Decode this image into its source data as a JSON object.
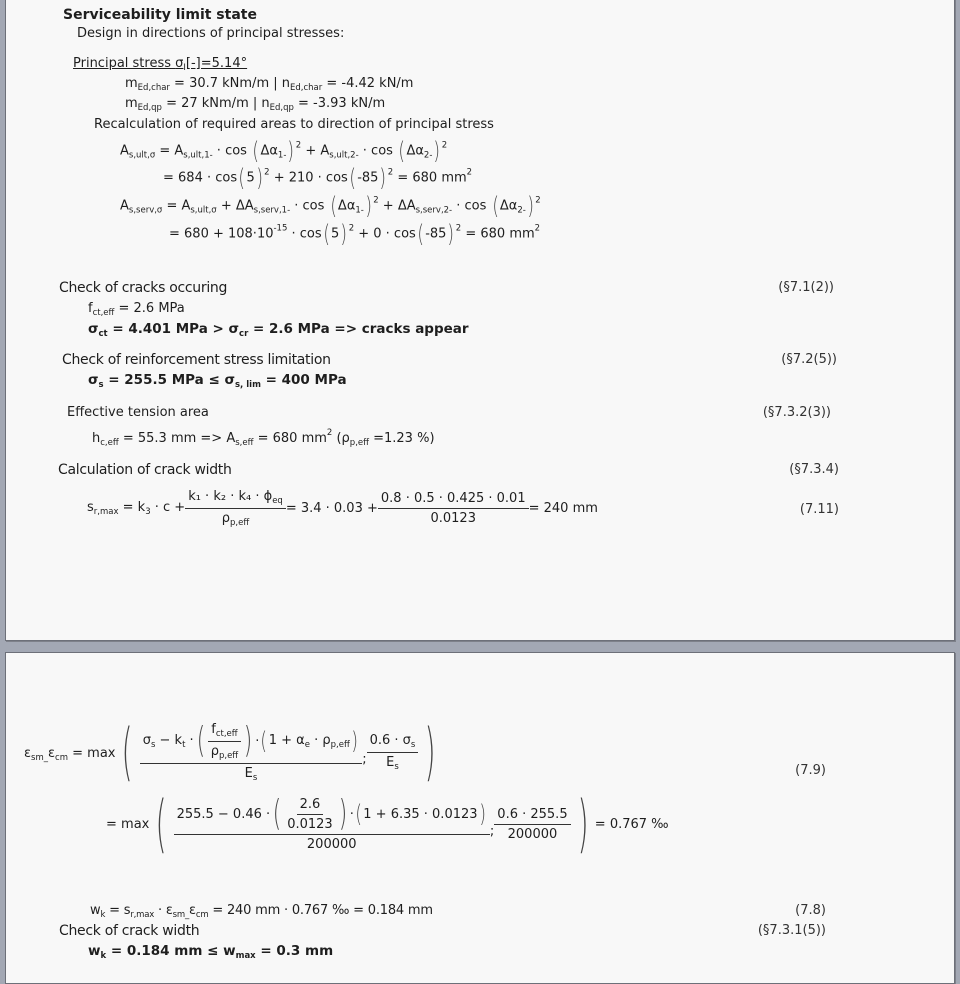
{
  "section": {
    "title": "Serviceability limit state",
    "subtitle": "Design in directions of principal stresses:"
  },
  "principal": {
    "label": "Principal stress",
    "sigma_label": "σ",
    "sigma_sub": "I",
    "sigma_rest": "[-]=5.14°",
    "char_line": {
      "m_sym": "m",
      "m_sub": "Ed,char",
      "m_val": " = 30.7  kNm/m  | ",
      "n_sym": "n",
      "n_sub": "Ed,char",
      "n_val": " = -4.42 kN/m"
    },
    "qp_line": {
      "m_sym": "m",
      "m_sub": "Ed,qp",
      "m_val": " = 27  kNm/m  | ",
      "n_sym": "n",
      "n_sub": "Ed,qp",
      "n_val": " = -3.93 kN/m"
    },
    "recalc_label": "Recalculation of required areas to direction of principal stress",
    "as_ult_formula": {
      "lhs": "A",
      "lhs_sub": "s,ult,σ",
      "t1": " = A",
      "t1_sub": "s,ult,1-",
      "t1_rest": " · cos ",
      "a1": "Δα",
      "a1_sub": "1-",
      "t2": " + A",
      "t2_sub": "s,ult,2-",
      "t2_rest": " · cos ",
      "a2": "Δα",
      "a2_sub": "2-"
    },
    "as_ult_values": {
      "p1": "= 684 · cos",
      "v1": "5",
      "p2": " + 210 · cos",
      "v2": "-85",
      "result": " = 680 mm"
    },
    "as_serv_formula": {
      "lhs": "A",
      "lhs_sub": "s,serv,σ",
      "t0": " = A",
      "t0_sub": "s,ult,σ",
      "t1": " + ΔA",
      "t1_sub": "s,serv,1-",
      "t1_rest": " · cos ",
      "a1": "Δα",
      "a1_sub": "1-",
      "t2": " + ΔA",
      "t2_sub": "s,serv,2-",
      "t2_rest": " · cos ",
      "a2": "Δα",
      "a2_sub": "2-"
    },
    "as_serv_values": {
      "p1": "= 680 + 108·10",
      "exp": "-15",
      "p1b": " · cos",
      "v1": "5",
      "p2": " + 0 · cos",
      "v2": "-85",
      "result": " = 680 mm"
    },
    "squared": "2"
  },
  "cracks_occurring": {
    "title": "Check of cracks occuring",
    "ref": "(§7.1(2))",
    "fct_sym": "f",
    "fct_sub": "ct,eff",
    "fct_val": " = 2.6 MPa",
    "result": {
      "s1": "σ",
      "s1_sub": "ct",
      "v1": " = 4.401 MPa > ",
      "s2": "σ",
      "s2_sub": "cr",
      "v2": " = 2.6 MPa  => cracks appear"
    }
  },
  "stress_limitation": {
    "title": "Check of reinforcement stress limitation",
    "ref": "(§7.2(5))",
    "s1": "σ",
    "s1_sub": "s",
    "v1": " = 255.5 MPa ≤ ",
    "s2": "σ",
    "s2_sub": "s, lim",
    "v2": " = 400 MPa"
  },
  "tension_area": {
    "title": "Effective tension area",
    "ref": "(§7.3.2(3))",
    "h": "h",
    "h_sub": "c,eff",
    "h_val": " = 55.3 mm => ",
    "a": "A",
    "a_sub": "s,eff",
    "a_val": " = 680 mm",
    "rho_open": " (ρ",
    "rho_sub": "p,eff",
    "rho_val": " =1.23 %)"
  },
  "crack_width": {
    "title": "Calculation of crack width",
    "ref": "(§7.3.4)",
    "eq_ref": "(7.11)",
    "srmax": {
      "lhs": "s",
      "lhs_sub": "r,max",
      "t1": " = k",
      "t1_sub": "3",
      "t1_rest": " · c + ",
      "num": "k₁ · k₂ · k₄ · ϕ",
      "num_sub": "eq",
      "den": "ρ",
      "den_sub": "p,eff",
      "mid": " = 3.4 · 0.03 + ",
      "num2": "0.8 · 0.5 · 0.425 · 0.01",
      "den2": "0.0123",
      "result": " = 240 mm"
    }
  },
  "strain": {
    "eq_ref": "(7.9)",
    "lhs": "ε",
    "lhs_sub1": "sm_",
    "lhs_mid": "ε",
    "lhs_sub2": "cm",
    "eq": " = max",
    "formula": {
      "sig": "σ",
      "sig_sub": "s",
      "minus": " − k",
      "kt_sub": "t",
      "dot": " · ",
      "fct": "f",
      "fct_sub": "ct,eff",
      "rho": "ρ",
      "rho_sub": "p,eff",
      "paren2": "1 + α",
      "alpha_sub": "e",
      "paren2b": " · ρ",
      "rho2_sub": "p,eff",
      "den": "E",
      "den_sub": "s",
      "sep": ";",
      "num2": "0.6 · σ",
      "num2_sub": "s",
      "den2": "E",
      "den2_sub": "s"
    },
    "values": {
      "eq": "= max",
      "n1": "255.5 − 0.46 · ",
      "fnum": "2.6",
      "fden": "0.0123",
      "n2": "1 + 6.35 · 0.0123",
      "den": "200000",
      "sep": ";",
      "num2": "0.6 · 255.5",
      "den2": "200000",
      "result": "= 0.767 ‰"
    }
  },
  "wk_calc": {
    "eq_ref": "(7.8)",
    "w": "w",
    "w_sub": "k",
    "t1": " = s",
    "t1_sub": "r,max",
    "t2": " · ε",
    "t2_sub": "sm_",
    "t3": "ε",
    "t3_sub": "cm",
    "rest": " = 240 mm · 0.767 ‰  = 0.184 mm"
  },
  "check_crack_width": {
    "title": "Check of crack width",
    "ref": "(§7.3.1(5))",
    "w": "w",
    "w_sub": "k",
    "v1": " = 0.184 mm ≤ ",
    "w2": "w",
    "w2_sub": "max",
    "v2": " = 0.3 mm"
  }
}
